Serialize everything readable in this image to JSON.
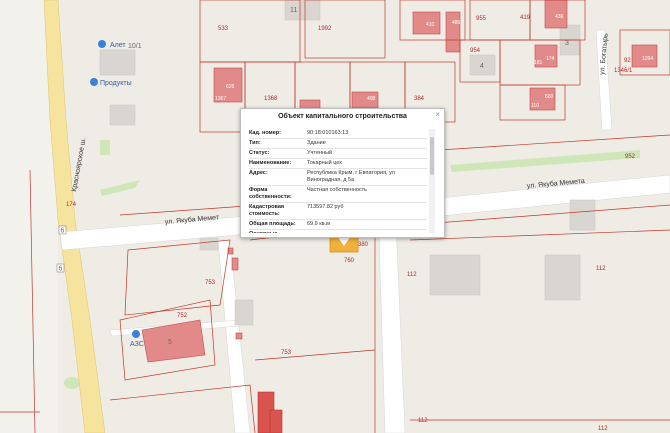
{
  "map": {
    "streets": {
      "krasnoyarskoe": "Красноярское ш.",
      "yakuba_memeta": "ул. Якуба Мемета",
      "yakuba_memeta_left": "ул. Якуба Мемет",
      "bogatyr": "ул. Богатырь"
    },
    "pois": {
      "alet": "Алет",
      "produkty": "Продукты",
      "azs": "АЗС"
    },
    "house_numbers": {
      "h11": "11",
      "h10_1": "10/1",
      "h4": "4",
      "h3": "3",
      "h5": "5"
    },
    "route_badges": {
      "r1": "6",
      "r2": "6"
    },
    "parcel_labels": {
      "p533": "533",
      "p1992": "1992",
      "p955": "955",
      "p419": "419",
      "p954": "954",
      "p92": "92",
      "p1346": "1346/1",
      "p1368": "1368",
      "p384": "384",
      "p952": "952",
      "p174": "174",
      "p753": "753",
      "p752": "752",
      "p753b": "753",
      "p760": "760",
      "p380": "380",
      "p112a": "112",
      "p112b": "112",
      "p112c": "112",
      "p112d": "112"
    },
    "building_labels": {
      "b1": "626",
      "b2": "408",
      "b3": "410",
      "b4": "436",
      "b5": "181",
      "b6": "174",
      "b7": "110",
      "b8": "1367",
      "b9": "1264",
      "b10": "486",
      "b11": "600"
    }
  },
  "popup": {
    "title": "Объект капитального строительства",
    "close": "×",
    "rows": [
      {
        "label": "Кад. номер:",
        "value": "90:18:010163:13"
      },
      {
        "label": "Тип:",
        "value": "Здание"
      },
      {
        "label": "Статус:",
        "value": "Учтенный"
      },
      {
        "label": "Наименование:",
        "value": "Токарный цех"
      },
      {
        "label": "Адрес:",
        "value": "Республика Крым, г Евпатория, ул Виноградная, д 5а"
      },
      {
        "label": "Форма собственности:",
        "value": "Частная собственность"
      },
      {
        "label": "Кадастровая стоимость:",
        "value": "713597.82 руб"
      },
      {
        "label": "Общая площадь:",
        "value": "69.9 кв.м"
      },
      {
        "label": "Основные характеристики:",
        "value": ""
      }
    ]
  }
}
